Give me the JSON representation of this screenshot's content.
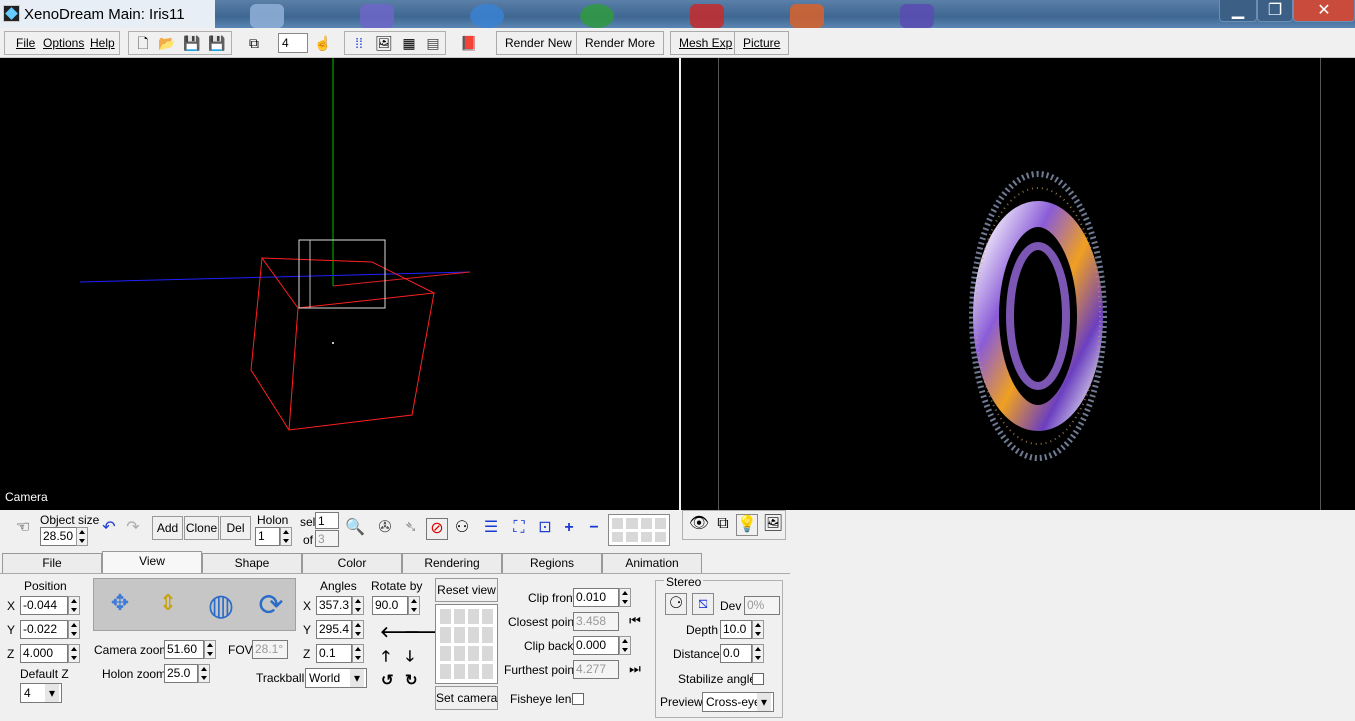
{
  "window": {
    "title": "XenoDream Main: Iris11"
  },
  "menu": {
    "file": "File",
    "options": "Options",
    "help": "Help"
  },
  "toolbar": {
    "quality_value": "4",
    "render_new": "Render New",
    "render_more": "Render More",
    "mesh_exp": "Mesh Exp",
    "picture": "Picture"
  },
  "viewport": {
    "camera_label": "Camera"
  },
  "controls": {
    "object_size_label": "Object size",
    "object_size_value": "28.50",
    "add": "Add",
    "clone": "Clone",
    "del": "Del",
    "holon_label": "Holon",
    "holon_value": "1",
    "sel_label": "sel",
    "sel_value": "1",
    "of_label": "of",
    "of_value": "3"
  },
  "tabs": [
    {
      "label": "File"
    },
    {
      "label": "View"
    },
    {
      "label": "Shape"
    },
    {
      "label": "Color"
    },
    {
      "label": "Rendering"
    },
    {
      "label": "Regions"
    },
    {
      "label": "Animation"
    }
  ],
  "view": {
    "position_label": "Position",
    "x_label": "X",
    "y_label": "Y",
    "z_label": "Z",
    "pos_x": "-0.044",
    "pos_y": "-0.022",
    "pos_z": "4.000",
    "default_z_label": "Default Z",
    "default_z_value": "4",
    "camera_zoom_label": "Camera zoom",
    "camera_zoom_value": "51.60",
    "fov_label": "FOV",
    "fov_value": "28.1°",
    "holon_zoom_label": "Holon zoom",
    "holon_zoom_value": "25.0",
    "angles_label": "Angles",
    "rotate_by_label": "Rotate by",
    "angle_x": "357.3",
    "angle_y": "295.4",
    "angle_z": "0.1",
    "rotate_by_value": "90.0",
    "trackball_label": "Trackball",
    "trackball_value": "World",
    "reset_view": "Reset view",
    "set_camera": "Set camera",
    "clip_front_label": "Clip front",
    "clip_front_value": "0.010",
    "closest_point_label": "Closest point",
    "closest_point_value": "3.458",
    "clip_back_label": "Clip back",
    "clip_back_value": "0.000",
    "furthest_point_label": "Furthest point",
    "furthest_point_value": "4.277",
    "fisheye_label": "Fisheye lens",
    "stereo_label": "Stereo",
    "dev_label": "Dev",
    "dev_value": "0%",
    "depth_label": "Depth",
    "depth_value": "10.0",
    "distance_label": "Distance",
    "distance_value": "0.0",
    "stabilize_label": "Stabilize angle",
    "preview_label": "Preview",
    "preview_value": "Cross-eye"
  }
}
